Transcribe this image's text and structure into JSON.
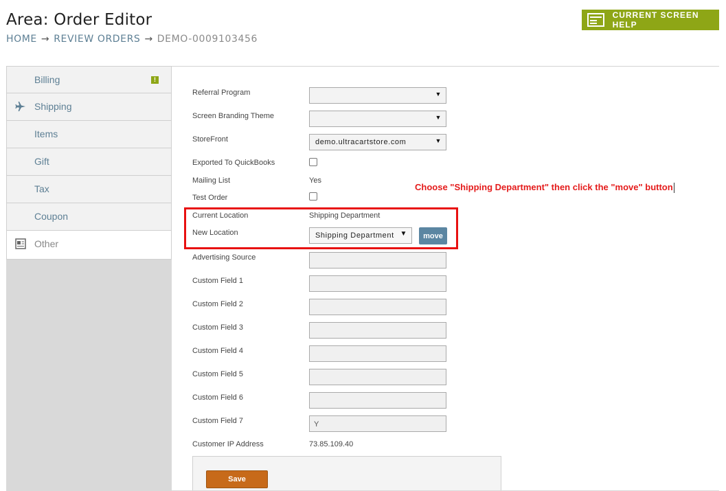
{
  "header": {
    "title": "Area: Order Editor",
    "breadcrumb": {
      "home": "HOME",
      "review": "REVIEW ORDERS",
      "current": "DEMO-0009103456",
      "sep": "→"
    },
    "help_label": "CURRENT SCREEN HELP"
  },
  "sidebar": {
    "items": [
      {
        "label": "Billing",
        "badge": "!"
      },
      {
        "label": "Shipping",
        "icon": "airplane-icon"
      },
      {
        "label": "Items"
      },
      {
        "label": "Gift"
      },
      {
        "label": "Tax"
      },
      {
        "label": "Coupon"
      },
      {
        "label": "Other",
        "icon": "document-icon"
      }
    ]
  },
  "form": {
    "referral_program": {
      "label": "Referral Program",
      "value": ""
    },
    "screen_branding": {
      "label": "Screen Branding Theme",
      "value": ""
    },
    "storefront": {
      "label": "StoreFront",
      "value": "demo.ultracartstore.com"
    },
    "exported_qb": {
      "label": "Exported To QuickBooks"
    },
    "mailing_list": {
      "label": "Mailing List",
      "value": "Yes"
    },
    "test_order": {
      "label": "Test Order"
    },
    "current_location": {
      "label": "Current Location",
      "value": "Shipping Department"
    },
    "new_location": {
      "label": "New Location",
      "value": "Shipping Department"
    },
    "move_label": "move",
    "advertising_source": {
      "label": "Advertising Source",
      "value": ""
    },
    "custom_fields": [
      {
        "label": "Custom Field 1",
        "value": ""
      },
      {
        "label": "Custom Field 2",
        "value": ""
      },
      {
        "label": "Custom Field 3",
        "value": ""
      },
      {
        "label": "Custom Field 4",
        "value": ""
      },
      {
        "label": "Custom Field 5",
        "value": ""
      },
      {
        "label": "Custom Field 6",
        "value": ""
      },
      {
        "label": "Custom Field 7",
        "value": "Y"
      }
    ],
    "customer_ip": {
      "label": "Customer IP Address",
      "value": "73.85.109.40"
    },
    "save_label": "Save"
  },
  "instruction": "Choose \"Shipping Department\" then click the \"move\" button",
  "colors": {
    "accent_green": "#8ea616",
    "link_blue": "#5d7f94",
    "save_orange": "#c76a1a",
    "highlight_red": "#e81010"
  }
}
